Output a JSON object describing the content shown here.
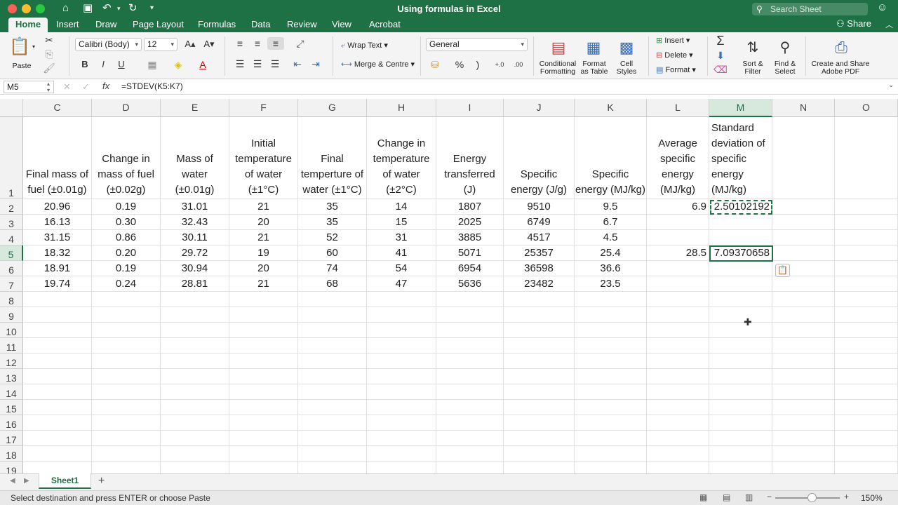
{
  "title_bar": {
    "document_title": "Using formulas in Excel",
    "search_placeholder": "Search Sheet"
  },
  "tabs": [
    "Home",
    "Insert",
    "Draw",
    "Page Layout",
    "Formulas",
    "Data",
    "Review",
    "View",
    "Acrobat"
  ],
  "share_label": "Share",
  "ribbon": {
    "paste": "Paste",
    "font_name": "Calibri (Body)",
    "font_size": "12",
    "wrap_text": "Wrap Text",
    "merge_centre": "Merge & Centre",
    "number_format": "General",
    "conditional_formatting": [
      "Conditional",
      "Formatting"
    ],
    "format_as_table": [
      "Format",
      "as Table"
    ],
    "cell_styles": [
      "Cell",
      "Styles"
    ],
    "insert": "Insert",
    "delete": "Delete",
    "format": "Format",
    "sort_filter": [
      "Sort &",
      "Filter"
    ],
    "find_select": [
      "Find &",
      "Select"
    ],
    "create_share_pdf": [
      "Create and Share",
      "Adobe PDF"
    ]
  },
  "formula_bar": {
    "name_box": "M5",
    "formula": "=STDEV(K5:K7)"
  },
  "columns": [
    "C",
    "D",
    "E",
    "F",
    "G",
    "H",
    "I",
    "J",
    "K",
    "L",
    "M",
    "N",
    "O"
  ],
  "rows": [
    "1",
    "2",
    "3",
    "4",
    "5",
    "6",
    "7",
    "8",
    "9",
    "10",
    "11",
    "12",
    "13",
    "14",
    "15",
    "16",
    "17",
    "18",
    "19"
  ],
  "header_row": [
    [
      "Final mass of",
      "fuel (±0.01g)"
    ],
    [
      "Change in",
      "mass of fuel",
      "(±0.02g)"
    ],
    [
      "Mass of",
      "water",
      "(±0.01g)"
    ],
    [
      "Initial",
      "temperature",
      "of water",
      "(±1°C)"
    ],
    [
      "Final",
      "temperture of",
      "water (±1°C)"
    ],
    [
      "Change in",
      "temperature",
      "of water",
      "(±2°C)"
    ],
    [
      "Energy",
      "transferred",
      "(J)"
    ],
    [
      "Specific",
      "energy (J/g)"
    ],
    [
      "Specific",
      "energy (MJ/kg)"
    ],
    [
      "Average",
      "specific",
      "energy",
      "(MJ/kg)"
    ],
    [
      "Standard",
      "deviation of",
      "specific",
      "energy",
      "(MJ/kg)"
    ]
  ],
  "data_rows": [
    [
      "20.96",
      "0.19",
      "31.01",
      "21",
      "35",
      "14",
      "1807",
      "9510",
      "9.5",
      "6.9",
      "2.50102192"
    ],
    [
      "16.13",
      "0.30",
      "32.43",
      "20",
      "35",
      "15",
      "2025",
      "6749",
      "6.7",
      "",
      ""
    ],
    [
      "31.15",
      "0.86",
      "30.11",
      "21",
      "52",
      "31",
      "3885",
      "4517",
      "4.5",
      "",
      ""
    ],
    [
      "18.32",
      "0.20",
      "29.72",
      "19",
      "60",
      "41",
      "5071",
      "25357",
      "25.4",
      "28.5",
      "7.09370658"
    ],
    [
      "18.91",
      "0.19",
      "30.94",
      "20",
      "74",
      "54",
      "6954",
      "36598",
      "36.6",
      "",
      ""
    ],
    [
      "19.74",
      "0.24",
      "28.81",
      "21",
      "68",
      "47",
      "5636",
      "23482",
      "23.5",
      "",
      ""
    ]
  ],
  "sheet_tab": "Sheet1",
  "status": {
    "text": "Select destination and press ENTER or choose Paste",
    "zoom": "150%"
  }
}
